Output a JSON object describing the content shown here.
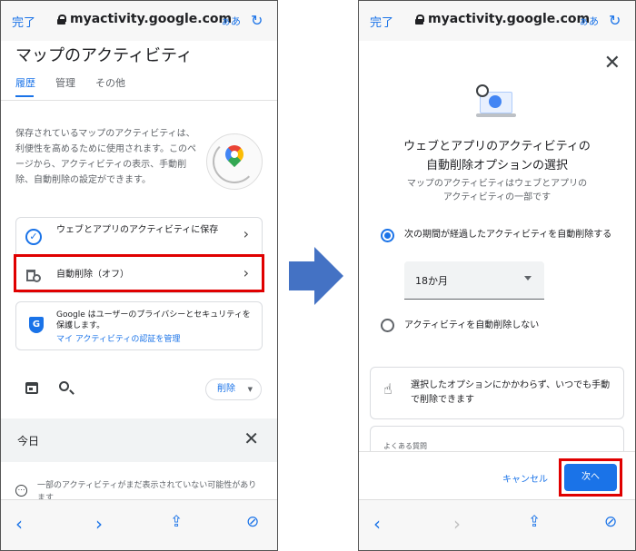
{
  "browser": {
    "done_label": "完了",
    "url": "myactivity.google.com",
    "text_size": "ぁあ"
  },
  "left": {
    "page_title": "マップのアクティビティ",
    "tabs": [
      "履歴",
      "管理",
      "その他"
    ],
    "intro": "保存されているマップのアクティビティは、利便性を高めるために使用されます。このページから、アクティビティの表示、手動削除、自動削除の設定ができます。",
    "settings": [
      {
        "label": "ウェブとアプリのアクティビティに保存",
        "icon": "check-circle-icon"
      },
      {
        "label": "自動削除（オフ）",
        "icon": "auto-delete-icon"
      }
    ],
    "security": {
      "text": "Google はユーザーのプライバシーとセキュリティを保護します。",
      "link": "マイ アクティビティの認証を管理"
    },
    "delete_label": "削除",
    "today_label": "今日",
    "notice": "一部のアクティビティがまだ表示されていない可能性があります"
  },
  "right": {
    "title_line1": "ウェブとアプリのアクティビティの",
    "title_line2": "自動削除オプションの選択",
    "subtitle_line1": "マップのアクティビティはウェブとアプリの",
    "subtitle_line2": "アクティビティの一部です",
    "option_auto": "次の期間が経過したアクティビティを自動削除する",
    "period_value": "18か月",
    "option_none": "アクティビティを自動削除しない",
    "info": "選択したオプションにかかわらず、いつでも手動で削除できます",
    "faq_label": "よくある質問",
    "cancel_label": "キャンセル",
    "next_label": "次へ"
  },
  "colors": {
    "accent": "#1a73e8",
    "highlight": "#e00000",
    "arrow": "#4472c4"
  }
}
